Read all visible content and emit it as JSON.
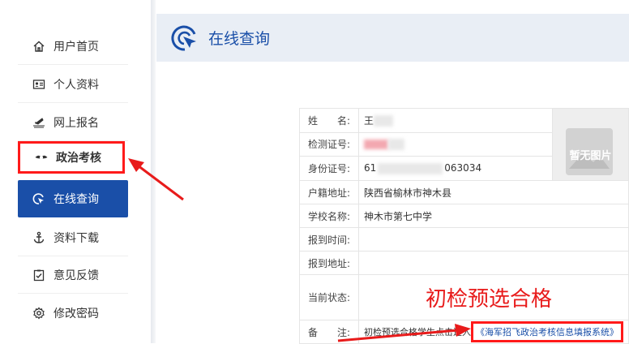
{
  "sidebar": {
    "items": [
      {
        "label": "用户首页",
        "icon": "home-icon"
      },
      {
        "label": "个人资料",
        "icon": "id-card-icon"
      },
      {
        "label": "网上报名",
        "icon": "jet-icon"
      },
      {
        "label": "政治考核",
        "icon": "badge-icon"
      },
      {
        "label": "在线查询",
        "icon": "query-icon"
      },
      {
        "label": "资料下载",
        "icon": "anchor-icon"
      },
      {
        "label": "意见反馈",
        "icon": "feedback-icon"
      },
      {
        "label": "修改密码",
        "icon": "gear-icon"
      }
    ],
    "active_index": 4,
    "highlight_index": 3
  },
  "header": {
    "title": "在线查询",
    "icon": "query-cursor-icon"
  },
  "info": {
    "name_label": "姓　　名:",
    "name_value": "王",
    "exam_id_label": "检测证号:",
    "id_card_label": "身份证号:",
    "id_card_prefix": "61",
    "id_card_suffix": "063034",
    "hukou_label": "户籍地址:",
    "hukou_value": "陕西省榆林市神木县",
    "school_label": "学校名称:",
    "school_value": "神木市第七中学",
    "report_time_label": "报到时间:",
    "report_time_value": "",
    "report_addr_label": "报到地址:",
    "report_addr_value": "",
    "status_label": "当前状态:",
    "status_value": "初检预选合格",
    "note_label": "备　　注:",
    "note_prefix": "初检预选合格学生点击进入",
    "note_link": "《海军招飞政治考核信息填报系统》",
    "photo_placeholder": "暂无图片"
  },
  "colors": {
    "primary": "#1a4fa8",
    "annotation": "#e81b1b",
    "header_bg": "#e9eef5"
  }
}
